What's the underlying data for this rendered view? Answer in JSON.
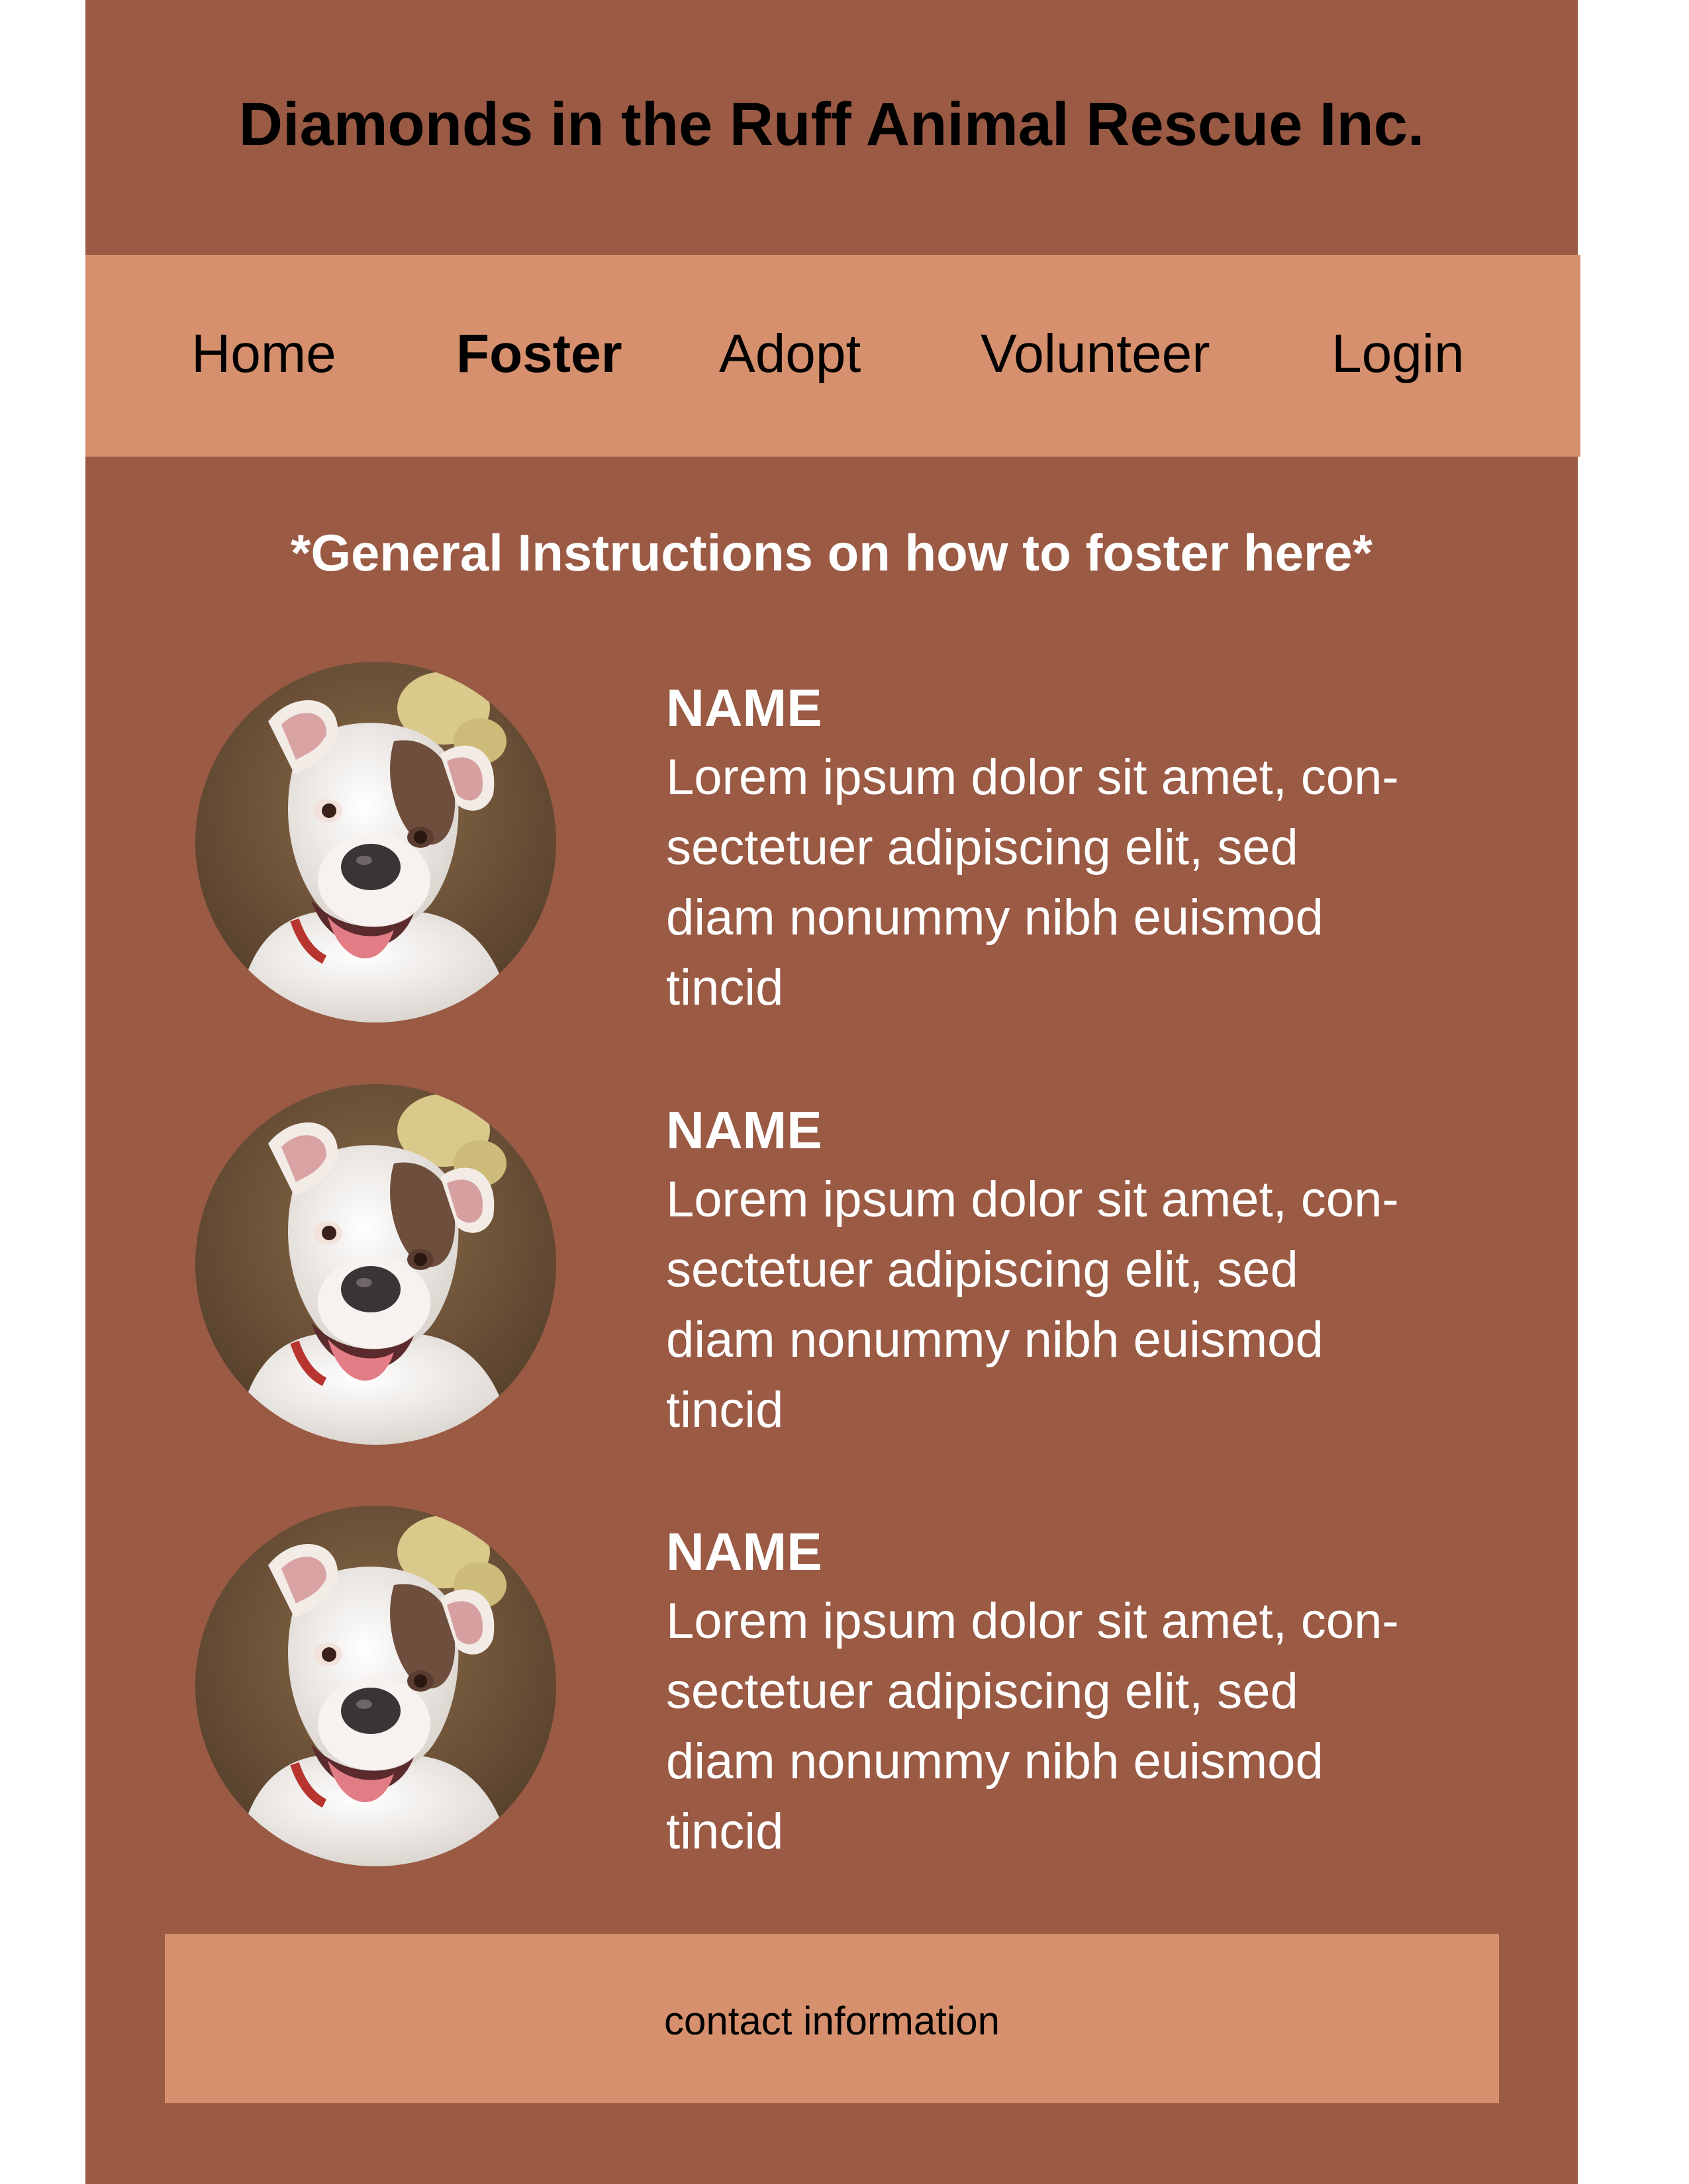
{
  "header": {
    "title": "Diamonds in the Ruff Animal Rescue Inc."
  },
  "nav": {
    "items": [
      {
        "label": "Home",
        "active": false
      },
      {
        "label": "Foster",
        "active": true
      },
      {
        "label": "Adopt",
        "active": false
      },
      {
        "label": "Volunteer",
        "active": false
      },
      {
        "label": "Login",
        "active": false
      }
    ]
  },
  "main": {
    "instructions": "*General Instructions on how to foster here*",
    "animals": [
      {
        "name": "NAME",
        "description_lines": [
          "Lorem ipsum dolor sit amet, con-",
          "sectetuer adipiscing elit, sed",
          "diam nonummy nibh euismod",
          "tincid"
        ],
        "photo_icon": "dog-photo"
      },
      {
        "name": "NAME",
        "description_lines": [
          "Lorem ipsum dolor sit amet, con-",
          "sectetuer adipiscing elit, sed",
          "diam nonummy nibh euismod",
          "tincid"
        ],
        "photo_icon": "dog-photo"
      },
      {
        "name": "NAME",
        "description_lines": [
          "Lorem ipsum dolor sit amet, con-",
          "sectetuer adipiscing elit, sed",
          "diam nonummy nibh euismod",
          "tincid"
        ],
        "photo_icon": "dog-photo"
      }
    ]
  },
  "footer": {
    "text": "contact information"
  },
  "colors": {
    "page_background": "#9a5a43",
    "nav_background": "#d6906d",
    "footer_background": "#d6906d",
    "title_text": "#000000",
    "card_text": "#ffffff"
  }
}
